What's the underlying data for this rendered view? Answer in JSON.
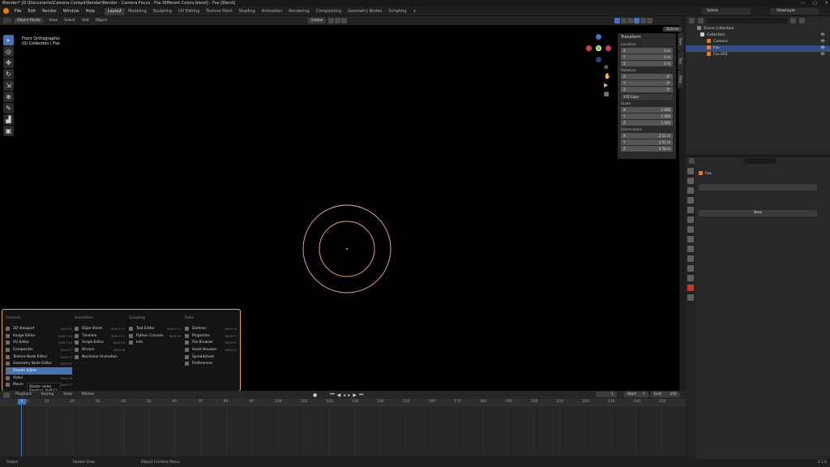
{
  "window": {
    "title": "Blender* [D:\\Documents\\Camera Cockpit\\Render\\Render - Camera Focus - Fox Different Colors.blend] - Fox [Blend]",
    "controls": [
      "—",
      "□",
      "✕"
    ]
  },
  "menubar": {
    "menus": [
      "File",
      "Edit",
      "Render",
      "Window",
      "Help"
    ],
    "workspaces": [
      "Layout",
      "Modeling",
      "Sculpting",
      "UV Editing",
      "Texture Paint",
      "Shading",
      "Animation",
      "Rendering",
      "Compositing",
      "Geometry Nodes",
      "Scripting"
    ],
    "active_workspace": "Layout",
    "add_tab": "+",
    "scene_label": "Scene",
    "viewlayer_label": "ViewLayer"
  },
  "viewport_header": {
    "mode": "Object Mode",
    "menus": [
      "View",
      "Select",
      "Add",
      "Object"
    ],
    "orientation": "Global",
    "options": "Options"
  },
  "viewport_info": {
    "line1": "Front Orthographic",
    "line2": "(0) Collection | Fox"
  },
  "toolbar": [
    "select",
    "cursor",
    "move",
    "rotate",
    "scale",
    "transform",
    "annotate",
    "measure",
    "add-cube"
  ],
  "npanel": {
    "header": "Transform",
    "location_label": "Location",
    "location": [
      {
        "axis": "X",
        "value": "0 m"
      },
      {
        "axis": "Y",
        "value": "0 m"
      },
      {
        "axis": "Z",
        "value": "0 m"
      }
    ],
    "rotation_label": "Rotation",
    "rotation": [
      {
        "axis": "X",
        "value": "0°"
      },
      {
        "axis": "Y",
        "value": "0°"
      },
      {
        "axis": "Z",
        "value": "0°"
      }
    ],
    "rotation_mode": "XYZ Euler",
    "scale_label": "Scale",
    "scale": [
      {
        "axis": "X",
        "value": "1.000"
      },
      {
        "axis": "Y",
        "value": "1.000"
      },
      {
        "axis": "Z",
        "value": "1.000"
      }
    ],
    "dimensions_label": "Dimensions",
    "dimensions": [
      {
        "axis": "X",
        "value": "2.51 m"
      },
      {
        "axis": "Y",
        "value": "2.51 m"
      },
      {
        "axis": "Z",
        "value": "2.56 m"
      }
    ],
    "tabs": [
      "Item",
      "Tool",
      "View"
    ]
  },
  "editor_menu": {
    "columns": [
      {
        "title": "General",
        "items": [
          {
            "label": "3D Viewport",
            "shortcut": "Shift F5"
          },
          {
            "label": "Image Editor",
            "shortcut": "Shift F10"
          },
          {
            "label": "UV Editor",
            "shortcut": "Shift F10"
          },
          {
            "label": "Compositor",
            "shortcut": "Shift F3"
          },
          {
            "label": "Texture Node Editor",
            "shortcut": "Shift F3"
          },
          {
            "label": "Geometry Node Editor",
            "shortcut": "Shift F3"
          },
          {
            "label": "Shader Editor",
            "shortcut": "Shift F3"
          },
          {
            "label": "Video",
            "shortcut": "Shift F8"
          },
          {
            "label": "Movie",
            "shortcut": "Shift F2"
          }
        ]
      },
      {
        "title": "Animation",
        "items": [
          {
            "label": "Dope Sheet",
            "shortcut": "Shift F12"
          },
          {
            "label": "Timeline",
            "shortcut": "Shift F12"
          },
          {
            "label": "Graph Editor",
            "shortcut": "Shift F6"
          },
          {
            "label": "Drivers",
            "shortcut": "Shift F6"
          },
          {
            "label": "Nonlinear Animation",
            "shortcut": ""
          }
        ]
      },
      {
        "title": "Scripting",
        "items": [
          {
            "label": "Text Editor",
            "shortcut": "Shift F11"
          },
          {
            "label": "Python Console",
            "shortcut": "Shift F4"
          },
          {
            "label": "Info",
            "shortcut": ""
          }
        ]
      },
      {
        "title": "Data",
        "items": [
          {
            "label": "Outliner",
            "shortcut": "Shift F9"
          },
          {
            "label": "Properties",
            "shortcut": "Shift F7"
          },
          {
            "label": "File Browser",
            "shortcut": "Shift F1"
          },
          {
            "label": "Asset Browser",
            "shortcut": "Shift F1"
          },
          {
            "label": "Spreadsheet",
            "shortcut": ""
          },
          {
            "label": "Preferences",
            "shortcut": ""
          }
        ]
      }
    ],
    "highlighted": "Shader Editor",
    "tooltip_line1": "Shader nodes",
    "tooltip_line2": "Shortcut: Shift F3"
  },
  "timeline": {
    "menus": [
      "Playback",
      "Keying",
      "View",
      "Marker"
    ],
    "current_frame": "1",
    "start_label": "Start",
    "start": "1",
    "end_label": "End",
    "end": "250",
    "ruler": [
      "0",
      "10",
      "20",
      "30",
      "40",
      "50",
      "60",
      "70",
      "80",
      "90",
      "100",
      "110",
      "120",
      "130",
      "140",
      "150",
      "160",
      "170",
      "180",
      "190",
      "200",
      "210",
      "220",
      "230",
      "240",
      "250"
    ]
  },
  "statusbar": {
    "items": [
      "Select",
      "Rotate View",
      "Object Context Menu"
    ],
    "version": "3.1.0"
  },
  "outliner": {
    "search_placeholder": "",
    "rows": [
      {
        "label": "Scene Collection",
        "indent": 0,
        "selected": false
      },
      {
        "label": "Collection",
        "indent": 1,
        "selected": false
      },
      {
        "label": "Camera",
        "indent": 2,
        "selected": false
      },
      {
        "label": "Fox",
        "indent": 2,
        "selected": true
      },
      {
        "label": "Fox.001",
        "indent": 2,
        "selected": false
      }
    ]
  },
  "properties": {
    "object_name": "Fox",
    "material_label": "New"
  },
  "colors": {
    "accent": "#4772b3",
    "menu_border": "#f0a73a",
    "outer_circle": "#e8a0a8",
    "inner_circle": "#f0a070",
    "gizmo_x": "#d63d4b",
    "gizmo_y": "#7ec230",
    "gizmo_z": "#3f73d6"
  }
}
